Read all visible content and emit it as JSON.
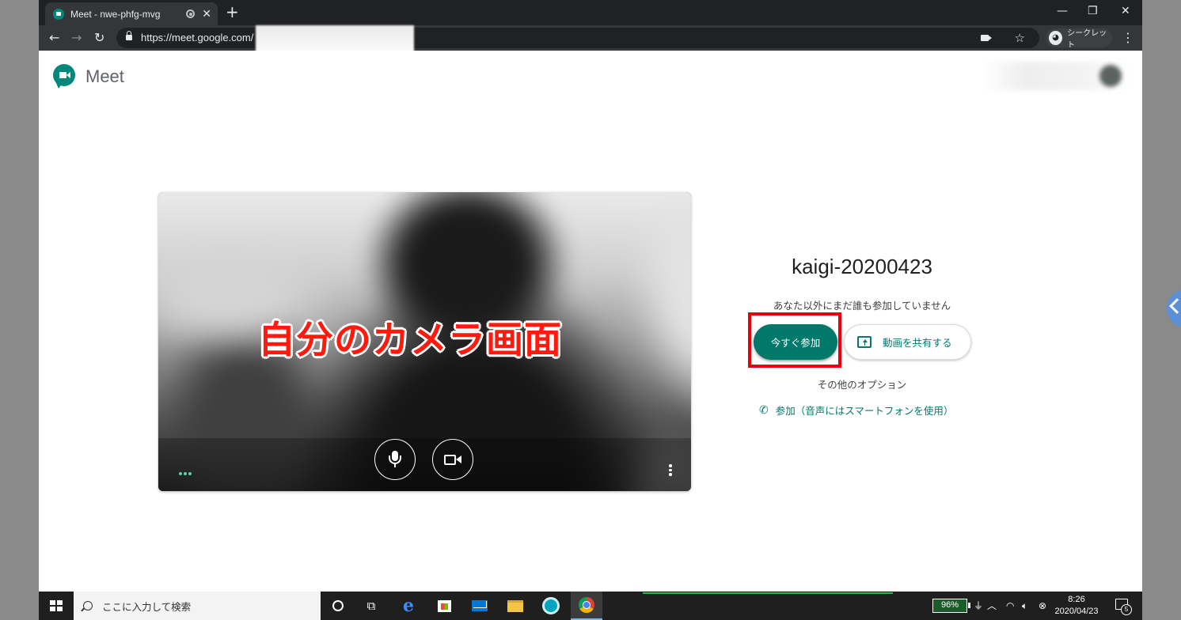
{
  "browser": {
    "tab_title": "Meet - nwe-phfg-mvg",
    "url": "https://meet.google.com/",
    "incognito_label": "シークレット"
  },
  "meet": {
    "logo_text": "Meet",
    "meeting_code": "kaigi-20200423",
    "status_text": "あなた以外にまだ誰も参加していません",
    "join_button": "今すぐ参加",
    "present_button": "動画を共有する",
    "other_options": "その他のオプション",
    "phone_join": "参加（音声にはスマートフォンを使用）",
    "brand_color": "#00796b"
  },
  "annotation": {
    "caption": "自分のカメラ画面",
    "highlight_color": "#e8000c"
  },
  "taskbar": {
    "search_placeholder": "ここに入力して検索",
    "battery": "96%",
    "time": "8:26",
    "date": "2020/04/23",
    "notification_count": "5"
  }
}
